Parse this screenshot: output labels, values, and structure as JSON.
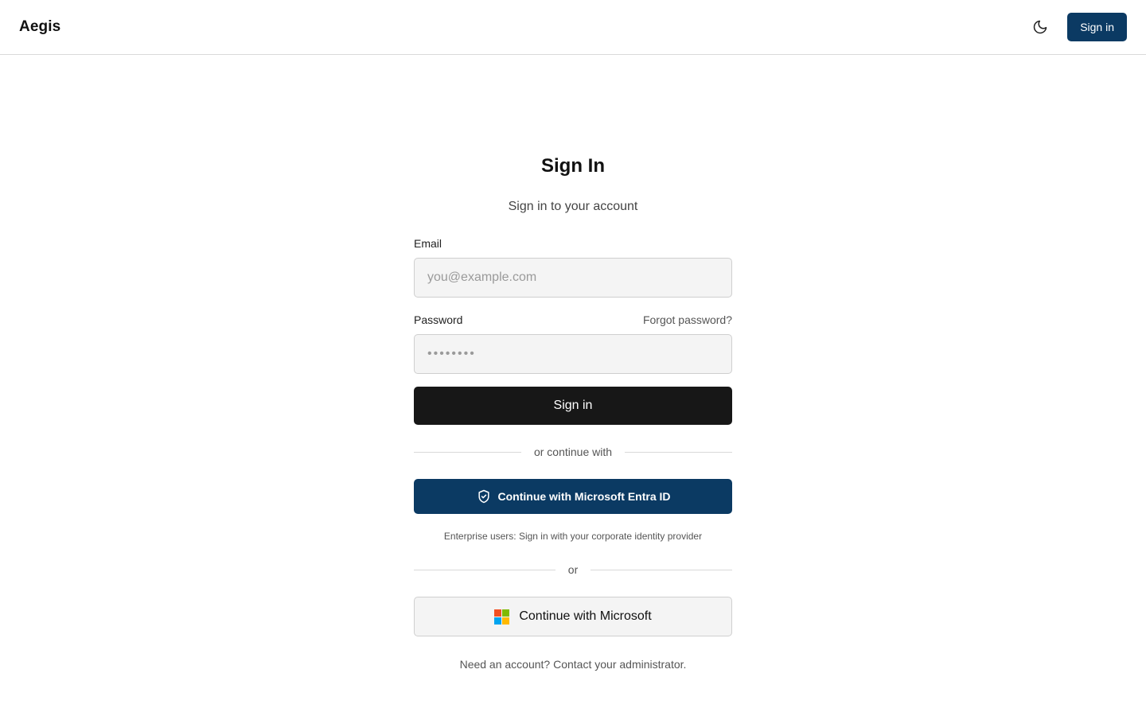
{
  "header": {
    "brand": "Aegis",
    "theme_icon": "moon-icon",
    "signin_label": "Sign in"
  },
  "form": {
    "title": "Sign In",
    "subtitle": "Sign in to your account",
    "email_label": "Email",
    "email_placeholder": "you@example.com",
    "email_value": "",
    "password_label": "Password",
    "forgot_label": "Forgot password?",
    "password_placeholder": "••••••••",
    "password_value": "",
    "submit_label": "Sign in"
  },
  "alternatives": {
    "divider_label": "or continue with",
    "entra_label": "Continue with Microsoft Entra ID",
    "entra_icon": "shield-check-icon",
    "entra_note": "Enterprise users: Sign in with your corporate identity provider",
    "or_label": "or",
    "microsoft_label": "Continue with Microsoft",
    "microsoft_icon": "microsoft-logo-icon"
  },
  "footer": {
    "note": "Need an account? Contact your administrator."
  },
  "colors": {
    "brand": "#0b3a63",
    "primary_button": "#171717",
    "ms_red": "#f25022",
    "ms_green": "#7fba00",
    "ms_blue": "#00a4ef",
    "ms_yellow": "#ffb900"
  }
}
